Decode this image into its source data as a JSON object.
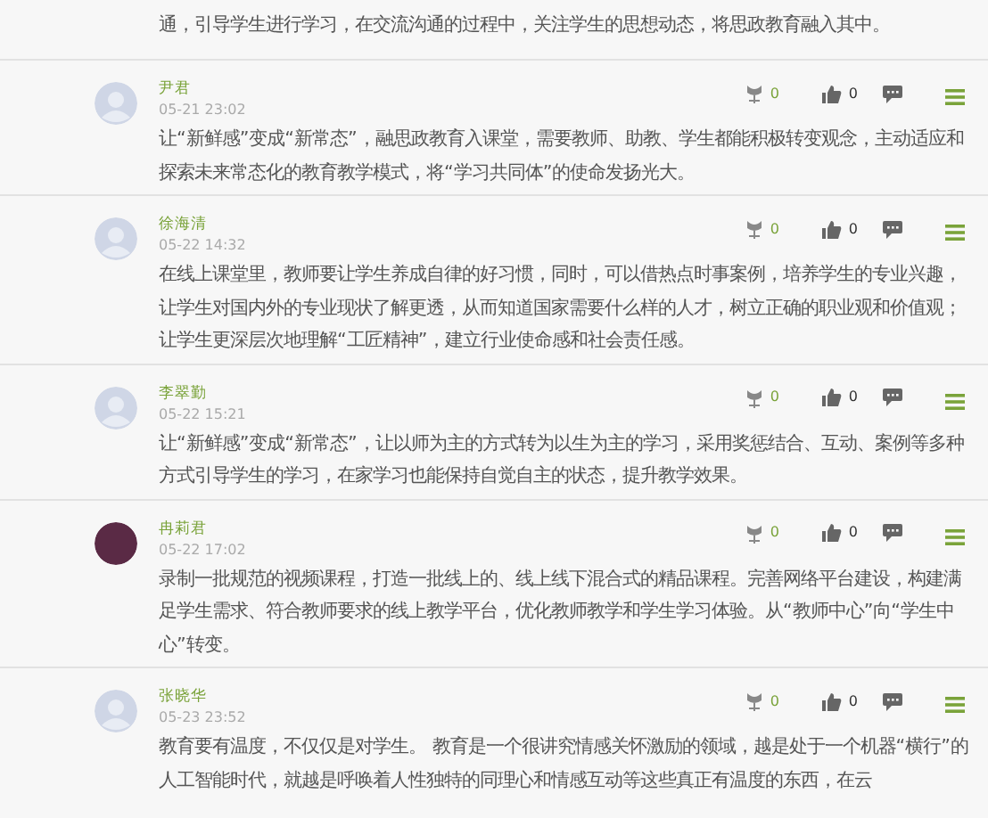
{
  "previous_comment_tail": "通，引导学生进行学习，在交流沟通的过程中，关注学生的思想动态，将思政教育融入其中。",
  "comments": [
    {
      "name": "尹君",
      "time": "05-21 23:02",
      "avatar": {
        "kind": "default"
      },
      "flowers": "0",
      "likes": "0",
      "text": "让“新鲜感”变成“新常态”，融思政教育入课堂，需要教师、助教、学生都能积极转变观念，主动适应和探索未来常态化的教育教学模式，将“学习共同体”的使命发扬光大。"
    },
    {
      "name": "徐海清",
      "time": "05-22 14:32",
      "avatar": {
        "kind": "default"
      },
      "flowers": "0",
      "likes": "0",
      "text": "在线上课堂里，教师要让学生养成自律的好习惯，同时，可以借热点时事案例，培养学生的专业兴趣，让学生对国内外的专业现状了解更透，从而知道国家需要什么样的人才，树立正确的职业观和价值观；让学生更深层次地理解“工匠精神”，建立行业使命感和社会责任感。"
    },
    {
      "name": "李翠勤",
      "time": "05-22 15:21",
      "avatar": {
        "kind": "default"
      },
      "flowers": "0",
      "likes": "0",
      "text": "让“新鲜感”变成“新常态”，让以师为主的方式转为以生为主的学习，采用奖惩结合、互动、案例等多种方式引导学生的学习，在家学习也能保持自觉自主的状态，提升教学效果。"
    },
    {
      "name": "冉莉君",
      "time": "05-22 17:02",
      "avatar": {
        "kind": "photo"
      },
      "flowers": "0",
      "likes": "0",
      "text": "录制一批规范的视频课程，打造一批线上的、线上线下混合式的精品课程。完善网络平台建设，构建满足学生需求、符合教师要求的线上教学平台，优化教师教学和学生学习体验。从“教师中心”向“学生中心”转变。"
    },
    {
      "name": "张晓华",
      "time": "05-23 23:52",
      "avatar": {
        "kind": "default"
      },
      "flowers": "0",
      "likes": "0",
      "text": "教育要有温度，不仅仅是对学生。 教育是一个很讲究情感关怀激励的领域，越是处于一个机器“横行”的人工智能时代，就越是呼唤着人性独特的同理心和情感互动等这些真正有温度的东西，在云"
    }
  ]
}
